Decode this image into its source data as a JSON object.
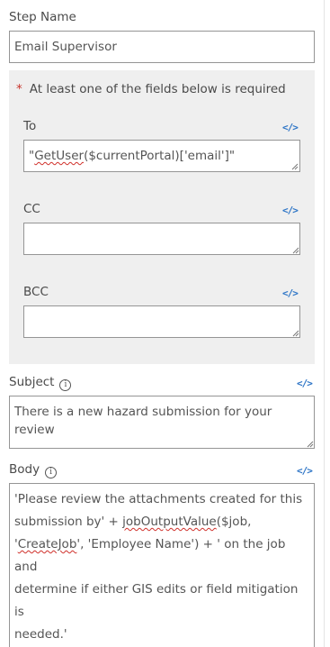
{
  "step_name": {
    "label": "Step Name",
    "value": "Email Supervisor"
  },
  "recipients": {
    "required_notice": "At least one of the fields below is required",
    "to": {
      "label": "To",
      "value_prefix": "\"",
      "value_misspelled": "GetUser",
      "value_suffix": "($currentPortal)['email']\""
    },
    "cc": {
      "label": "CC",
      "value": ""
    },
    "bcc": {
      "label": "BCC",
      "value": ""
    }
  },
  "subject": {
    "label": "Subject",
    "value": "There is a new hazard submission for your review"
  },
  "body": {
    "label": "Body",
    "line1": "'Please review the attachments created for this",
    "line2_pre": "submission by' + ",
    "line2_misspelled": "jobOutputValue",
    "line2_post": "($job,",
    "line3_pre": "'",
    "line3_misspelled": "CreateJob",
    "line3_post": "', 'Employee Name') + ' on the job and",
    "line4": "determine if either GIS edits or field mitigation is",
    "line5": "needed.'"
  },
  "icons": {
    "expression": "code-icon",
    "info": "info-icon",
    "info_glyph": "i",
    "expression_glyph": "</>"
  },
  "colors": {
    "accent": "#2c74c6",
    "required": "#c8332b",
    "group_background": "#efefef"
  }
}
